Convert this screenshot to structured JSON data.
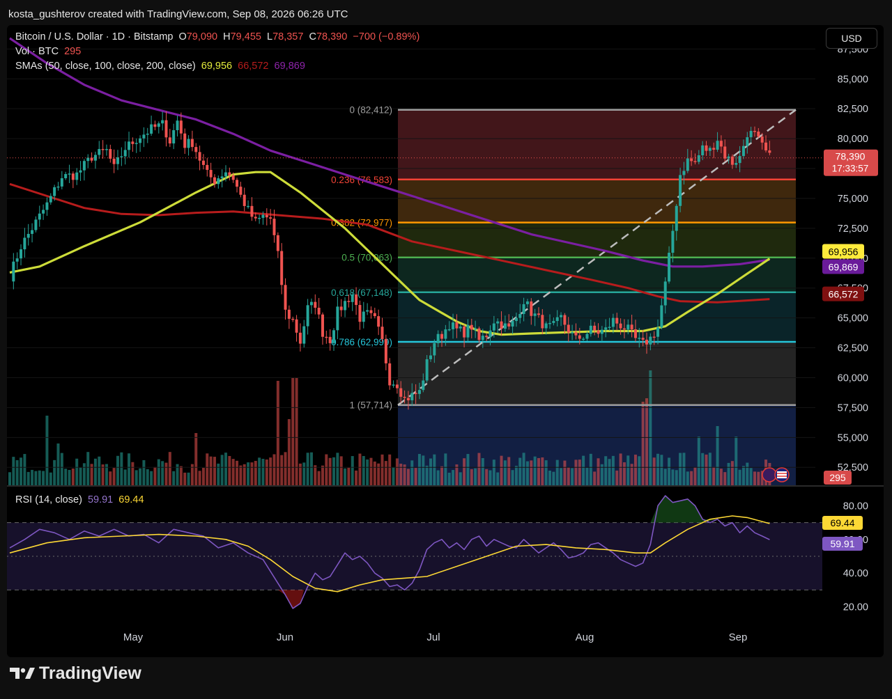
{
  "header": {
    "creator_text": "kosta_gushterov created with TradingView.com, Sep 08, 2026 06:26 UTC",
    "currency_button": "USD"
  },
  "legend": {
    "symbol": "Bitcoin / U.S. Dollar · 1D · Bitstamp",
    "o_label": "O",
    "o_value": "79,090",
    "h_label": "H",
    "h_value": "79,455",
    "l_label": "L",
    "l_value": "78,357",
    "c_label": "C",
    "c_value": "78,390",
    "change": "−700 (−0.89%)",
    "vol_label": "Vol · BTC",
    "vol_value": "295",
    "sma_label": "SMAs (50, close, 100, close, 200, close)",
    "sma50": "69,956",
    "sma100": "66,572",
    "sma200": "69,869",
    "rsi_label": "RSI (14, close)",
    "rsi_value": "59.91",
    "rsi_ma": "69.44"
  },
  "brand": {
    "name": "TradingView"
  },
  "colors": {
    "up": "#26a69a",
    "down": "#ef5350",
    "sma50": "#cddc39",
    "sma100": "#b71c1c",
    "sma200": "#7b1fa2",
    "rsi": "#7e57c2",
    "rsi_ma": "#fdd835"
  },
  "chart_data": {
    "type": "candlestick",
    "symbol": "Bitcoin / U.S. Dollar",
    "interval": "1D",
    "exchange": "Bitstamp",
    "price_axis": {
      "ticks": [
        52500,
        55000,
        57500,
        60000,
        62500,
        65000,
        67500,
        70000,
        72500,
        75000,
        77500,
        80000,
        82500,
        85000,
        87500
      ],
      "tick_labels": [
        "52,500",
        "55,000",
        "57,500",
        "60,000",
        "62,500",
        "65,000",
        "67,500",
        "70,000",
        "72,500",
        "75,000",
        "77,500",
        "80,000",
        "82,500",
        "85,000",
        "87,500"
      ],
      "range": [
        51000,
        89500
      ]
    },
    "time_axis": {
      "labels": [
        "May",
        "Jun",
        "Jul",
        "Aug",
        "Sep"
      ]
    },
    "last_price": {
      "value": "78,390",
      "countdown": "17:33:57"
    },
    "axis_badges": [
      {
        "name": "sma50",
        "label": "69,956",
        "value": 69956,
        "color": "#ffeb3b",
        "text_color": "#000000"
      },
      {
        "name": "sma200",
        "label": "69,869",
        "value": 69869,
        "color": "#6a1b9a",
        "text_color": "#ffffff"
      },
      {
        "name": "sma100",
        "label": "66,572",
        "value": 66572,
        "color": "#7f1010",
        "text_color": "#ffffff"
      },
      {
        "name": "volume",
        "label": "295",
        "color": "#d84a4a",
        "text_color": "#ffffff"
      }
    ],
    "candles_approx": {
      "note_hidden": "",
      "anchors": [
        [
          0,
          68500
        ],
        [
          3,
          71000
        ],
        [
          6,
          72500
        ],
        [
          10,
          74500
        ],
        [
          14,
          76800
        ],
        [
          18,
          77000
        ],
        [
          22,
          78500
        ],
        [
          26,
          79000
        ],
        [
          28,
          77500
        ],
        [
          31,
          79200
        ],
        [
          35,
          80200
        ],
        [
          38,
          80800
        ],
        [
          41,
          81200
        ],
        [
          43,
          79800
        ],
        [
          45,
          81500
        ],
        [
          47,
          79500
        ],
        [
          49,
          79700
        ],
        [
          51,
          78300
        ],
        [
          53,
          77000
        ],
        [
          55,
          76500
        ],
        [
          58,
          77300
        ],
        [
          60,
          76700
        ],
        [
          62,
          75200
        ],
        [
          64,
          74000
        ],
        [
          66,
          73000
        ],
        [
          68,
          73500
        ],
        [
          70,
          73300
        ],
        [
          72,
          70200
        ],
        [
          74,
          65500
        ],
        [
          76,
          64800
        ],
        [
          78,
          63000
        ],
        [
          80,
          65800
        ],
        [
          82,
          66200
        ],
        [
          84,
          63800
        ],
        [
          86,
          63200
        ],
        [
          88,
          65500
        ],
        [
          90,
          66300
        ],
        [
          92,
          67000
        ],
        [
          94,
          65000
        ],
        [
          96,
          65300
        ],
        [
          98,
          64800
        ],
        [
          100,
          63000
        ],
        [
          102,
          59800
        ],
        [
          104,
          59500
        ],
        [
          106,
          58200
        ],
        [
          108,
          58500
        ],
        [
          110,
          58800
        ],
        [
          112,
          61200
        ],
        [
          114,
          63000
        ],
        [
          116,
          63600
        ],
        [
          118,
          64500
        ],
        [
          120,
          64000
        ],
        [
          122,
          63800
        ],
        [
          124,
          64300
        ],
        [
          126,
          63100
        ],
        [
          128,
          63600
        ],
        [
          130,
          64800
        ],
        [
          132,
          64500
        ],
        [
          134,
          64100
        ],
        [
          136,
          65000
        ],
        [
          138,
          66500
        ],
        [
          140,
          65500
        ],
        [
          142,
          64900
        ],
        [
          144,
          64200
        ],
        [
          146,
          64300
        ],
        [
          148,
          65000
        ],
        [
          150,
          64000
        ],
        [
          152,
          63200
        ],
        [
          154,
          63500
        ],
        [
          156,
          64000
        ],
        [
          158,
          63800
        ],
        [
          160,
          64000
        ],
        [
          162,
          64800
        ],
        [
          164,
          64400
        ],
        [
          166,
          64000
        ],
        [
          168,
          63200
        ],
        [
          170,
          62800
        ],
        [
          172,
          63300
        ],
        [
          174,
          64200
        ],
        [
          176,
          67800
        ],
        [
          178,
          72300
        ],
        [
          180,
          77000
        ],
        [
          182,
          78200
        ],
        [
          184,
          78000
        ],
        [
          186,
          79200
        ],
        [
          188,
          79000
        ],
        [
          190,
          80000
        ],
        [
          192,
          78600
        ],
        [
          194,
          78000
        ],
        [
          196,
          78400
        ],
        [
          198,
          80500
        ],
        [
          200,
          80300
        ],
        [
          202,
          79300
        ],
        [
          204,
          78400
        ]
      ],
      "count": 205
    },
    "series": [
      {
        "name": "SMA 50",
        "last": 69956,
        "points": [
          [
            0,
            68800
          ],
          [
            8,
            69300
          ],
          [
            20,
            71000
          ],
          [
            35,
            73000
          ],
          [
            50,
            75500
          ],
          [
            60,
            77000
          ],
          [
            66,
            77200
          ],
          [
            70,
            77200
          ],
          [
            78,
            75500
          ],
          [
            90,
            72500
          ],
          [
            100,
            69500
          ],
          [
            110,
            66500
          ],
          [
            120,
            64700
          ],
          [
            126,
            63900
          ],
          [
            132,
            63600
          ],
          [
            140,
            63700
          ],
          [
            150,
            63800
          ],
          [
            160,
            63900
          ],
          [
            170,
            63900
          ],
          [
            176,
            64300
          ],
          [
            182,
            65500
          ],
          [
            190,
            67000
          ],
          [
            198,
            68700
          ],
          [
            204,
            69956
          ]
        ]
      },
      {
        "name": "SMA 100",
        "last": 66572,
        "points": [
          [
            0,
            76200
          ],
          [
            10,
            75200
          ],
          [
            20,
            74200
          ],
          [
            30,
            73700
          ],
          [
            40,
            73600
          ],
          [
            50,
            73800
          ],
          [
            60,
            73900
          ],
          [
            72,
            73600
          ],
          [
            84,
            73300
          ],
          [
            96,
            72800
          ],
          [
            108,
            71400
          ],
          [
            120,
            70600
          ],
          [
            132,
            69800
          ],
          [
            144,
            69000
          ],
          [
            156,
            68200
          ],
          [
            166,
            67500
          ],
          [
            174,
            66800
          ],
          [
            180,
            66400
          ],
          [
            190,
            66300
          ],
          [
            204,
            66572
          ]
        ]
      },
      {
        "name": "SMA 200",
        "last": 69869,
        "points": [
          [
            0,
            88400
          ],
          [
            10,
            86300
          ],
          [
            20,
            84500
          ],
          [
            30,
            83200
          ],
          [
            40,
            82400
          ],
          [
            50,
            81600
          ],
          [
            60,
            80400
          ],
          [
            70,
            79000
          ],
          [
            80,
            78000
          ],
          [
            90,
            77000
          ],
          [
            100,
            76000
          ],
          [
            110,
            75000
          ],
          [
            120,
            74000
          ],
          [
            130,
            73000
          ],
          [
            140,
            72000
          ],
          [
            150,
            71300
          ],
          [
            160,
            70600
          ],
          [
            170,
            69800
          ],
          [
            178,
            69300
          ],
          [
            186,
            69300
          ],
          [
            196,
            69500
          ],
          [
            204,
            69869
          ]
        ]
      }
    ],
    "fibonacci": [
      {
        "label": "0 (82,412)",
        "level": 0,
        "price": 82412,
        "color": "#9e9e9e",
        "fill": "#4d1a1f"
      },
      {
        "label": "0.236 (76,583)",
        "level": 0.236,
        "price": 76583,
        "color": "#f44336",
        "fill": "#4a2f0f"
      },
      {
        "label": "0.382 (72,977)",
        "level": 0.382,
        "price": 72977,
        "color": "#ff9800",
        "fill": "#25300f"
      },
      {
        "label": "0.5 (70,063)",
        "level": 0.5,
        "price": 70063,
        "color": "#4caf50",
        "fill": "#0f2e25"
      },
      {
        "label": "0.618 (67,148)",
        "level": 0.618,
        "price": 67148,
        "color": "#26a69a",
        "fill": "#0c2a30"
      },
      {
        "label": "0.786 (62,999)",
        "level": 0.786,
        "price": 62999,
        "color": "#26c6da",
        "fill": "#2a2a2a"
      },
      {
        "label": "1 (57,714)",
        "level": 1,
        "price": 57714,
        "color": "#9e9e9e",
        "fill": "#14224a"
      }
    ],
    "rsi": {
      "name": "RSI (14, close)",
      "last": 59.91,
      "ma_last": 69.44,
      "ticks": [
        20,
        40,
        60,
        80
      ],
      "tick_labels": [
        "20.00",
        "40.00",
        "60.00",
        "80.00"
      ],
      "bands": [
        30,
        50,
        70
      ],
      "range": [
        14,
        86
      ],
      "points": [
        [
          0,
          55
        ],
        [
          4,
          60
        ],
        [
          8,
          66
        ],
        [
          12,
          64
        ],
        [
          16,
          60
        ],
        [
          20,
          65
        ],
        [
          24,
          62
        ],
        [
          28,
          66
        ],
        [
          32,
          62
        ],
        [
          36,
          63
        ],
        [
          40,
          58
        ],
        [
          44,
          66
        ],
        [
          48,
          64
        ],
        [
          52,
          62
        ],
        [
          56,
          55
        ],
        [
          60,
          58
        ],
        [
          64,
          52
        ],
        [
          68,
          48
        ],
        [
          72,
          34
        ],
        [
          74,
          27
        ],
        [
          76,
          19
        ],
        [
          78,
          22
        ],
        [
          80,
          32
        ],
        [
          82,
          40
        ],
        [
          84,
          36
        ],
        [
          86,
          38
        ],
        [
          88,
          45
        ],
        [
          90,
          52
        ],
        [
          92,
          48
        ],
        [
          94,
          50
        ],
        [
          96,
          46
        ],
        [
          98,
          40
        ],
        [
          100,
          37
        ],
        [
          102,
          32
        ],
        [
          104,
          33
        ],
        [
          106,
          30
        ],
        [
          108,
          34
        ],
        [
          110,
          42
        ],
        [
          112,
          54
        ],
        [
          114,
          58
        ],
        [
          116,
          60
        ],
        [
          118,
          55
        ],
        [
          120,
          58
        ],
        [
          122,
          54
        ],
        [
          124,
          60
        ],
        [
          126,
          62
        ],
        [
          128,
          56
        ],
        [
          130,
          60
        ],
        [
          132,
          58
        ],
        [
          134,
          56
        ],
        [
          136,
          55
        ],
        [
          138,
          60
        ],
        [
          140,
          56
        ],
        [
          142,
          52
        ],
        [
          144,
          55
        ],
        [
          146,
          58
        ],
        [
          148,
          54
        ],
        [
          150,
          49
        ],
        [
          152,
          50
        ],
        [
          154,
          52
        ],
        [
          156,
          57
        ],
        [
          158,
          58
        ],
        [
          160,
          55
        ],
        [
          162,
          52
        ],
        [
          164,
          48
        ],
        [
          166,
          46
        ],
        [
          168,
          44
        ],
        [
          170,
          46
        ],
        [
          172,
          57
        ],
        [
          174,
          80
        ],
        [
          176,
          86
        ],
        [
          178,
          82
        ],
        [
          180,
          83
        ],
        [
          182,
          84
        ],
        [
          184,
          80
        ],
        [
          186,
          72
        ],
        [
          188,
          70
        ],
        [
          190,
          72
        ],
        [
          192,
          68
        ],
        [
          194,
          70
        ],
        [
          196,
          64
        ],
        [
          198,
          68
        ],
        [
          200,
          64
        ],
        [
          202,
          62
        ],
        [
          204,
          59.91
        ]
      ],
      "ma_points": [
        [
          0,
          52
        ],
        [
          10,
          58
        ],
        [
          20,
          61
        ],
        [
          30,
          62
        ],
        [
          40,
          63
        ],
        [
          50,
          62
        ],
        [
          58,
          60
        ],
        [
          64,
          56
        ],
        [
          70,
          48
        ],
        [
          76,
          38
        ],
        [
          82,
          31
        ],
        [
          88,
          29
        ],
        [
          94,
          33
        ],
        [
          100,
          36
        ],
        [
          106,
          37
        ],
        [
          112,
          38
        ],
        [
          120,
          44
        ],
        [
          128,
          50
        ],
        [
          136,
          56
        ],
        [
          144,
          57
        ],
        [
          152,
          55
        ],
        [
          160,
          54
        ],
        [
          168,
          52
        ],
        [
          172,
          52
        ],
        [
          176,
          58
        ],
        [
          182,
          66
        ],
        [
          188,
          72
        ],
        [
          194,
          74
        ],
        [
          198,
          73
        ],
        [
          204,
          69.44
        ]
      ]
    }
  }
}
